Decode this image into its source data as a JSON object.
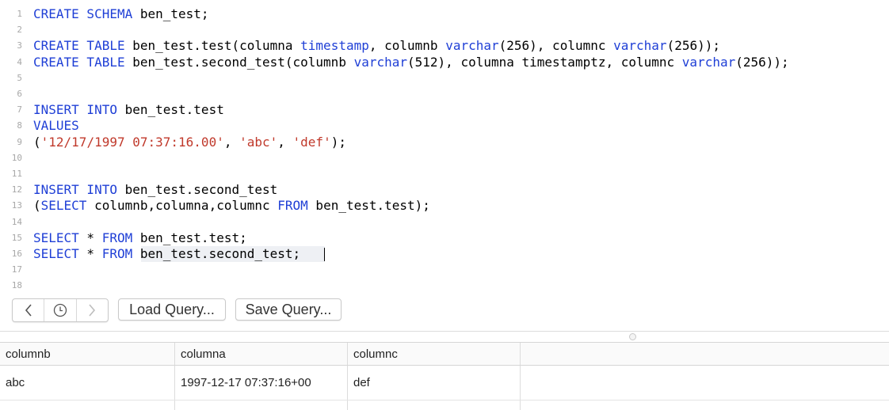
{
  "editor": {
    "lines": [
      {
        "n": "1",
        "tokens": [
          {
            "t": "CREATE SCHEMA",
            "c": "k"
          },
          {
            "t": " ben_test;",
            "c": "p"
          }
        ]
      },
      {
        "n": "2",
        "tokens": []
      },
      {
        "n": "3",
        "tokens": [
          {
            "t": "CREATE TABLE",
            "c": "k"
          },
          {
            "t": " ben_test.test(columna ",
            "c": "p"
          },
          {
            "t": "timestamp",
            "c": "k"
          },
          {
            "t": ", columnb ",
            "c": "p"
          },
          {
            "t": "varchar",
            "c": "k"
          },
          {
            "t": "(256), columnc ",
            "c": "p"
          },
          {
            "t": "varchar",
            "c": "k"
          },
          {
            "t": "(256));",
            "c": "p"
          }
        ]
      },
      {
        "n": "4",
        "tokens": [
          {
            "t": "CREATE TABLE",
            "c": "k"
          },
          {
            "t": " ben_test.second_test(columnb ",
            "c": "p"
          },
          {
            "t": "varchar",
            "c": "k"
          },
          {
            "t": "(512), columna timestamptz, columnc ",
            "c": "p"
          },
          {
            "t": "varchar",
            "c": "k"
          },
          {
            "t": "(256));",
            "c": "p"
          }
        ]
      },
      {
        "n": "5",
        "tokens": []
      },
      {
        "n": "6",
        "tokens": []
      },
      {
        "n": "7",
        "tokens": [
          {
            "t": "INSERT INTO",
            "c": "k"
          },
          {
            "t": " ben_test.test",
            "c": "p"
          }
        ]
      },
      {
        "n": "8",
        "tokens": [
          {
            "t": "VALUES",
            "c": "k"
          }
        ]
      },
      {
        "n": "9",
        "tokens": [
          {
            "t": "(",
            "c": "p"
          },
          {
            "t": "'12/17/1997 07:37:16.00'",
            "c": "s"
          },
          {
            "t": ", ",
            "c": "p"
          },
          {
            "t": "'abc'",
            "c": "s"
          },
          {
            "t": ", ",
            "c": "p"
          },
          {
            "t": "'def'",
            "c": "s"
          },
          {
            "t": ");",
            "c": "p"
          }
        ]
      },
      {
        "n": "10",
        "tokens": []
      },
      {
        "n": "11",
        "tokens": []
      },
      {
        "n": "12",
        "tokens": [
          {
            "t": "INSERT INTO",
            "c": "k"
          },
          {
            "t": " ben_test.second_test",
            "c": "p"
          }
        ]
      },
      {
        "n": "13",
        "tokens": [
          {
            "t": "(",
            "c": "p"
          },
          {
            "t": "SELECT",
            "c": "k"
          },
          {
            "t": " columnb,columna,columnc ",
            "c": "p"
          },
          {
            "t": "FROM",
            "c": "k"
          },
          {
            "t": " ben_test.test);",
            "c": "p"
          }
        ]
      },
      {
        "n": "14",
        "tokens": []
      },
      {
        "n": "15",
        "tokens": [
          {
            "t": "SELECT",
            "c": "k"
          },
          {
            "t": " * ",
            "c": "p"
          },
          {
            "t": "FROM",
            "c": "k"
          },
          {
            "t": " ben_test.test;",
            "c": "p"
          }
        ]
      },
      {
        "n": "16",
        "tokens": [
          {
            "t": "SELECT",
            "c": "k"
          },
          {
            "t": " * ",
            "c": "p"
          },
          {
            "t": "FROM",
            "c": "k"
          },
          {
            "t": " ben_test.second_test;",
            "c": "p"
          }
        ]
      },
      {
        "n": "17",
        "tokens": []
      },
      {
        "n": "18",
        "tokens": []
      }
    ]
  },
  "toolbar": {
    "back_icon": "chevron-left-icon",
    "history_icon": "clock-icon",
    "forward_icon": "chevron-right-icon",
    "load_label": "Load Query...",
    "save_label": "Save Query..."
  },
  "results": {
    "columns": [
      "columnb",
      "columna",
      "columnc"
    ],
    "rows": [
      [
        "abc",
        "1997-12-17 07:37:16+00",
        "def"
      ]
    ]
  },
  "colors": {
    "keyword": "#1f3fd6",
    "string": "#c0392b",
    "line_number": "#a8a8a8"
  }
}
